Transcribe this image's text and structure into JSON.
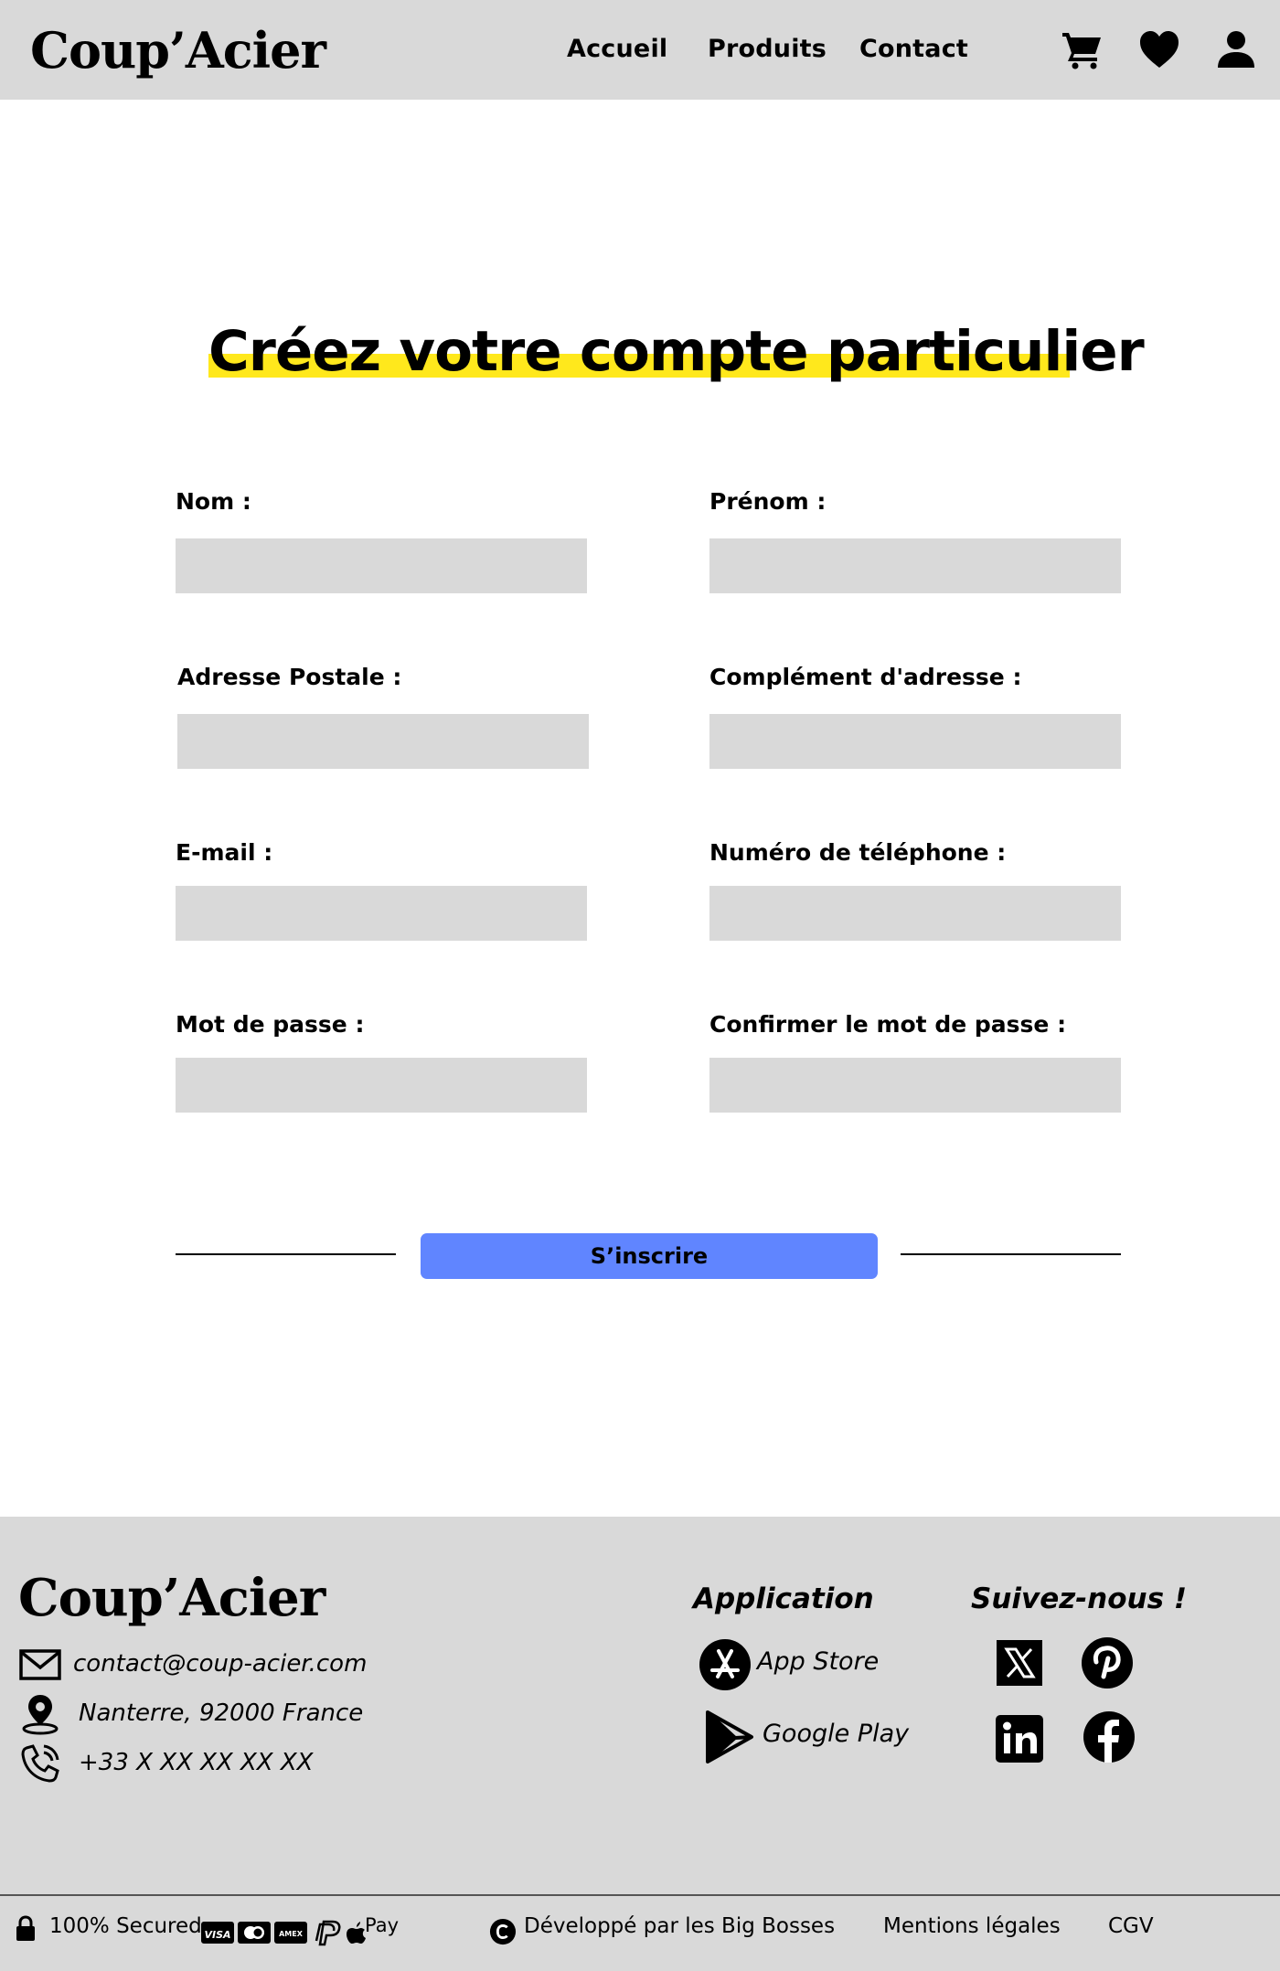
{
  "header": {
    "brand": "Coup’Acier",
    "nav": [
      "Accueil",
      "Produits",
      "Contact"
    ],
    "icons": [
      "cart-icon",
      "heart-icon",
      "user-icon"
    ]
  },
  "main": {
    "title": "Créez votre compte particulier",
    "highlight_color": "#ffe81c",
    "fields": {
      "nom": "Nom :",
      "prenom": "Prénom :",
      "adresse": "Adresse Postale :",
      "complement": "Complément d'adresse :",
      "email": "E-mail :",
      "telephone": "Numéro de téléphone :",
      "mdp": "Mot de passe :",
      "mdp_confirm": "Confirmer le mot de passe :"
    },
    "submit_label": "S’inscrire",
    "submit_color": "#6085ff"
  },
  "footer": {
    "brand": "Coup’Acier",
    "contact": {
      "email": "contact@coup-acier.com",
      "address": "Nanterre, 92000 France",
      "phone": "+33 X XX XX XX XX"
    },
    "application_heading": "Application",
    "app_store": "App Store",
    "google_play": "Google Play",
    "social_heading": "Suivez-nous !",
    "social": [
      "x-icon",
      "pinterest-icon",
      "linkedin-icon",
      "facebook-icon"
    ],
    "secured": "100% Secured",
    "payment_icons": [
      "visa-icon",
      "mastercard-icon",
      "amex-icon",
      "paypal-icon",
      "apple-pay-icon"
    ],
    "apple_pay_label": "Pay",
    "credits": "Développé par les Big Bosses",
    "legal": "Mentions légales",
    "cgv": "CGV"
  }
}
